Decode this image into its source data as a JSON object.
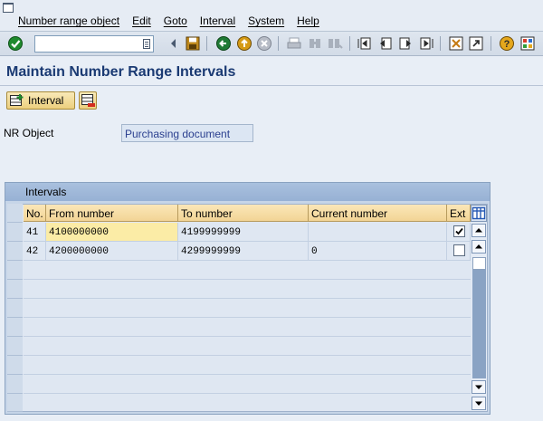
{
  "menubar": {
    "items": [
      "Number range object",
      "Edit",
      "Goto",
      "Interval",
      "System",
      "Help"
    ]
  },
  "toolbar": {
    "command_field_value": "",
    "icons": [
      "enter-icon",
      "save-icon",
      "back-icon",
      "exit-icon",
      "cancel-icon",
      "print-icon",
      "find-icon",
      "find-next-icon",
      "first-page-icon",
      "previous-page-icon",
      "next-page-icon",
      "last-page-icon",
      "create-session-icon",
      "shortcut-icon",
      "help-icon",
      "layout-icon"
    ]
  },
  "page": {
    "title": "Maintain Number Range Intervals"
  },
  "app_toolbar": {
    "interval_label": "Interval"
  },
  "nr_object": {
    "label": "NR Object",
    "value": "Purchasing document"
  },
  "table": {
    "caption": "Intervals",
    "columns": [
      "No.",
      "From number",
      "To number",
      "Current number",
      "Ext"
    ],
    "rows": [
      {
        "no": "41",
        "from": "4100000000",
        "to": "4199999999",
        "current": "",
        "ext": true
      },
      {
        "no": "42",
        "from": "4200000000",
        "to": "4299999999",
        "current": "0",
        "ext": false
      }
    ]
  },
  "colors": {
    "title": "#1a3a73",
    "header": "#f2d495",
    "highlight": "#fbeca6",
    "caption": "#97b1d4"
  }
}
